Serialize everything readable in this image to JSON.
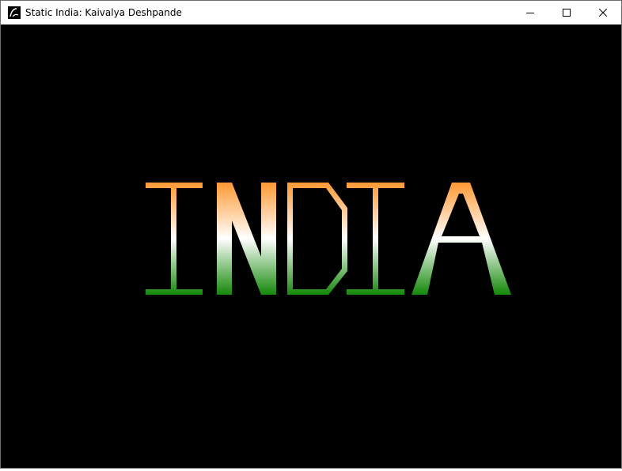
{
  "window": {
    "title": "Static India: Kaivalya Deshpande",
    "background_color": "#000000"
  },
  "titlebar": {
    "app_icon": "opengl-app-icon",
    "buttons": [
      {
        "name": "minimize-button",
        "icon": "minimize-icon"
      },
      {
        "name": "maximize-button",
        "icon": "maximize-icon"
      },
      {
        "name": "close-button",
        "icon": "close-icon"
      }
    ]
  },
  "scene": {
    "word": "INDIA",
    "letters": [
      "I",
      "N",
      "D",
      "I",
      "A"
    ],
    "gradient": {
      "top": "#FF9933",
      "middle": "#FFFFFF",
      "bottom": "#138808"
    }
  }
}
